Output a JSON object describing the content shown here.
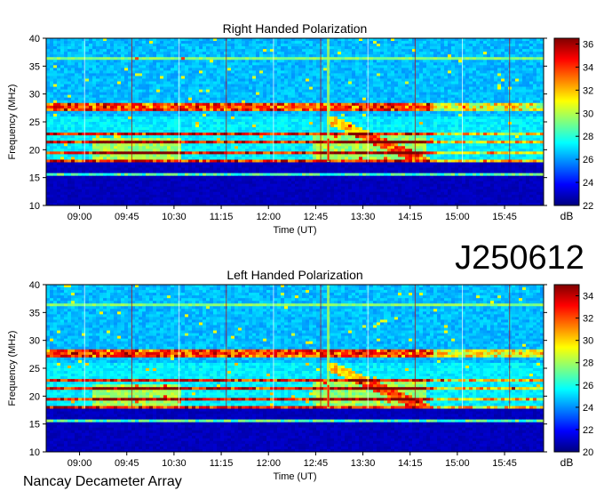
{
  "page": {
    "obs_id": "J250612",
    "instrument": "Nancay Decameter Array"
  },
  "palette": [
    "#00007f",
    "#0000ff",
    "#007fff",
    "#00ffff",
    "#7fff7f",
    "#ffff00",
    "#ff7f00",
    "#ff0000",
    "#7f0000"
  ],
  "chart_data": [
    {
      "type": "heatmap",
      "title": "Right Handed Polarization",
      "xlabel": "Time (UT)",
      "ylabel": "Frequency (MHz)",
      "x_ticks": [
        "09:00",
        "09:45",
        "10:30",
        "11:15",
        "12:00",
        "12:45",
        "13:30",
        "14:15",
        "15:00",
        "15:45"
      ],
      "x_tick_hours": [
        9.0,
        9.75,
        10.5,
        11.25,
        12.0,
        12.75,
        13.5,
        14.25,
        15.0,
        15.75
      ],
      "xlim_hours": [
        8.47,
        16.37
      ],
      "y_ticks": [
        10,
        15,
        20,
        25,
        30,
        35,
        40
      ],
      "ylim": [
        10,
        40
      ],
      "colorbar": {
        "label": "dB",
        "ticks": [
          22,
          24,
          26,
          28,
          30,
          32,
          34,
          36
        ],
        "range": [
          22,
          36.5
        ]
      },
      "emission_bands_mhz": [
        18.0,
        19.5,
        21.5,
        22.8,
        27.3,
        28.0
      ],
      "cutoff_mhz": 17.8,
      "burst_hour": 12.95,
      "interference_lines_mhz": [
        36.2,
        15.5
      ]
    },
    {
      "type": "heatmap",
      "title": "Left Handed Polarization",
      "xlabel": "Time (UT)",
      "ylabel": "Frequency (MHz)",
      "x_ticks": [
        "09:00",
        "09:45",
        "10:30",
        "11:15",
        "12:00",
        "12:45",
        "13:30",
        "14:15",
        "15:00",
        "15:45"
      ],
      "x_tick_hours": [
        9.0,
        9.75,
        10.5,
        11.25,
        12.0,
        12.75,
        13.5,
        14.25,
        15.0,
        15.75
      ],
      "xlim_hours": [
        8.47,
        16.37
      ],
      "y_ticks": [
        10,
        15,
        20,
        25,
        30,
        35,
        40
      ],
      "ylim": [
        10,
        40
      ],
      "colorbar": {
        "label": "dB",
        "ticks": [
          20,
          22,
          24,
          26,
          28,
          30,
          32,
          34
        ],
        "range": [
          20,
          35
        ]
      },
      "emission_bands_mhz": [
        18.0,
        19.5,
        21.5,
        22.8,
        27.3,
        28.0
      ],
      "cutoff_mhz": 17.8,
      "burst_hour": 12.95,
      "interference_lines_mhz": [
        36.2,
        15.5
      ]
    }
  ]
}
